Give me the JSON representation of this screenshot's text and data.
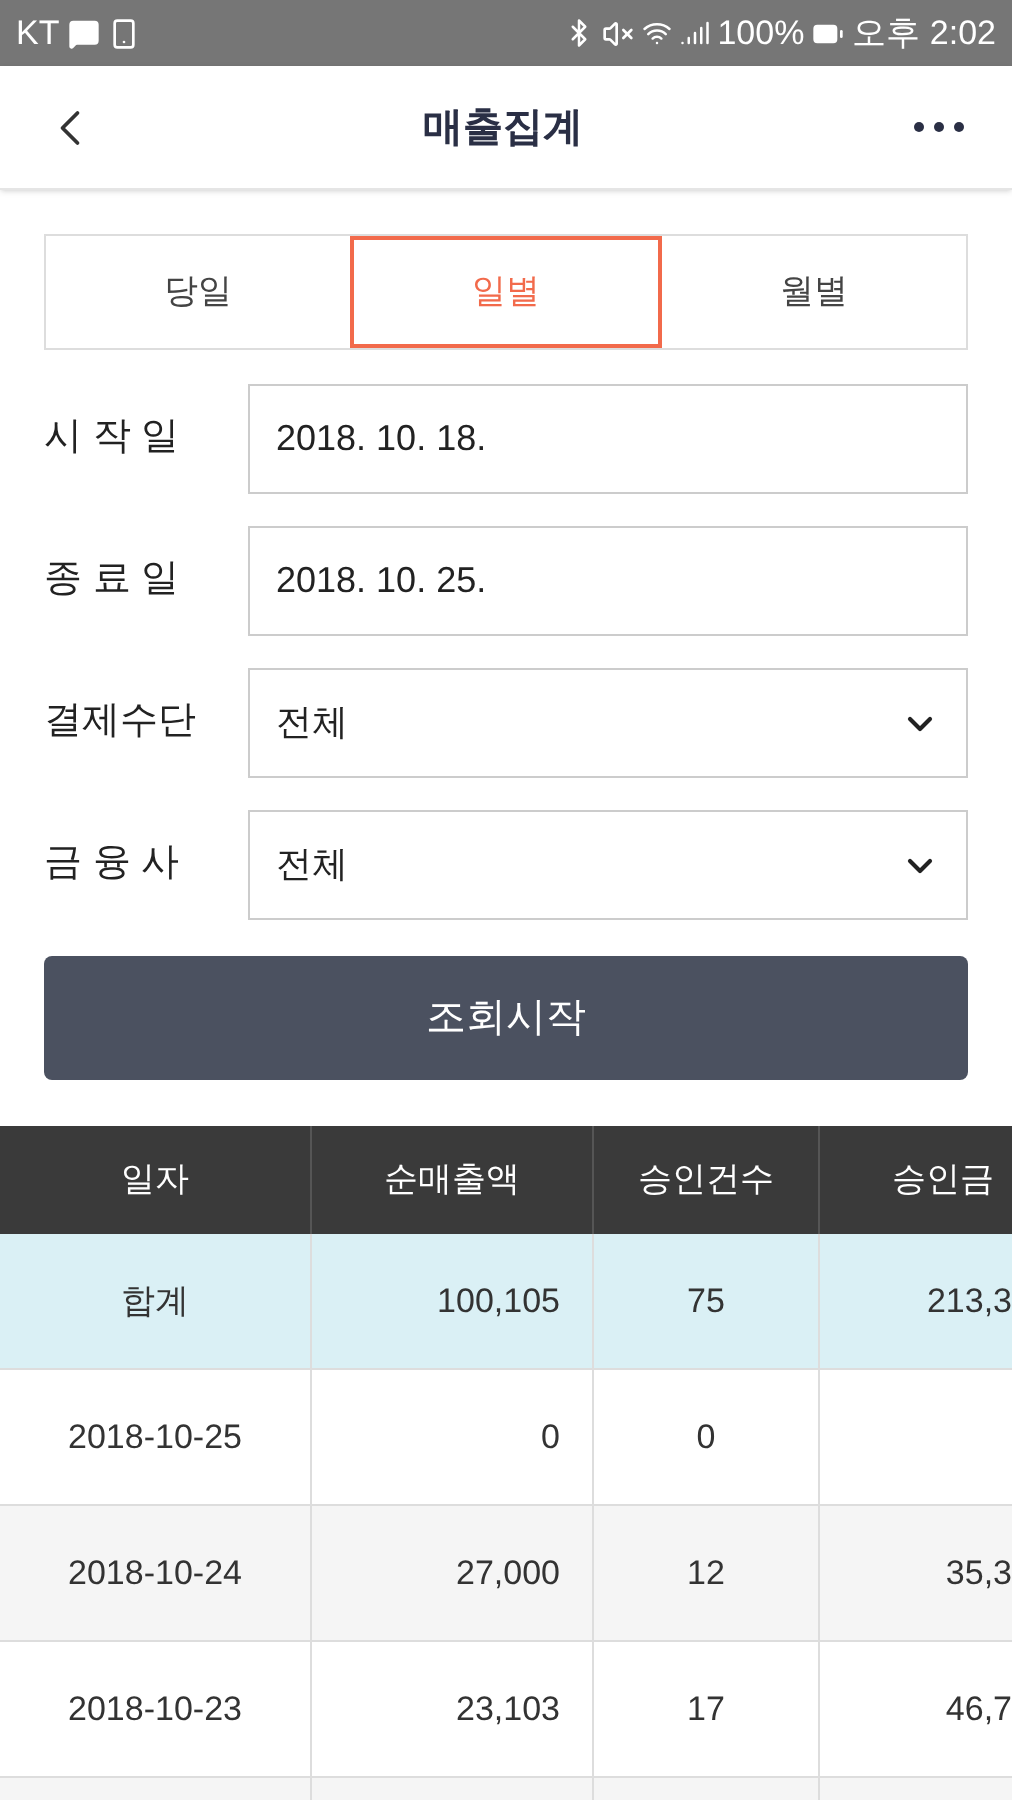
{
  "status_bar": {
    "carrier": "KT",
    "battery": "100%",
    "time": "오후 2:02"
  },
  "header": {
    "title": "매출집계"
  },
  "tabs": [
    {
      "label": "당일",
      "selected": false
    },
    {
      "label": "일별",
      "selected": true
    },
    {
      "label": "월별",
      "selected": false
    }
  ],
  "form": [
    {
      "kind": "date",
      "label": "시 작 일",
      "value": "2018. 10. 18."
    },
    {
      "kind": "date",
      "label": "종 료 일",
      "value": "2018. 10. 25."
    },
    {
      "kind": "select",
      "label": "결제수단",
      "value": "전체"
    },
    {
      "kind": "select",
      "label": "금 융 사",
      "value": "전체"
    }
  ],
  "search_button": "조회시작",
  "table": {
    "columns": [
      "일자",
      "순매출액",
      "승인건수",
      "승인금"
    ],
    "rows": [
      {
        "kind": "total",
        "cells": [
          "합계",
          "100,105",
          "75",
          "213,3"
        ]
      },
      {
        "kind": "day",
        "cells": [
          "2018-10-25",
          "0",
          "0",
          ""
        ]
      },
      {
        "kind": "day",
        "cells": [
          "2018-10-24",
          "27,000",
          "12",
          "35,3"
        ]
      },
      {
        "kind": "day",
        "cells": [
          "2018-10-23",
          "23,103",
          "17",
          "46,7"
        ]
      },
      {
        "kind": "day",
        "cells": [
          "",
          "",
          "",
          ""
        ]
      }
    ]
  }
}
